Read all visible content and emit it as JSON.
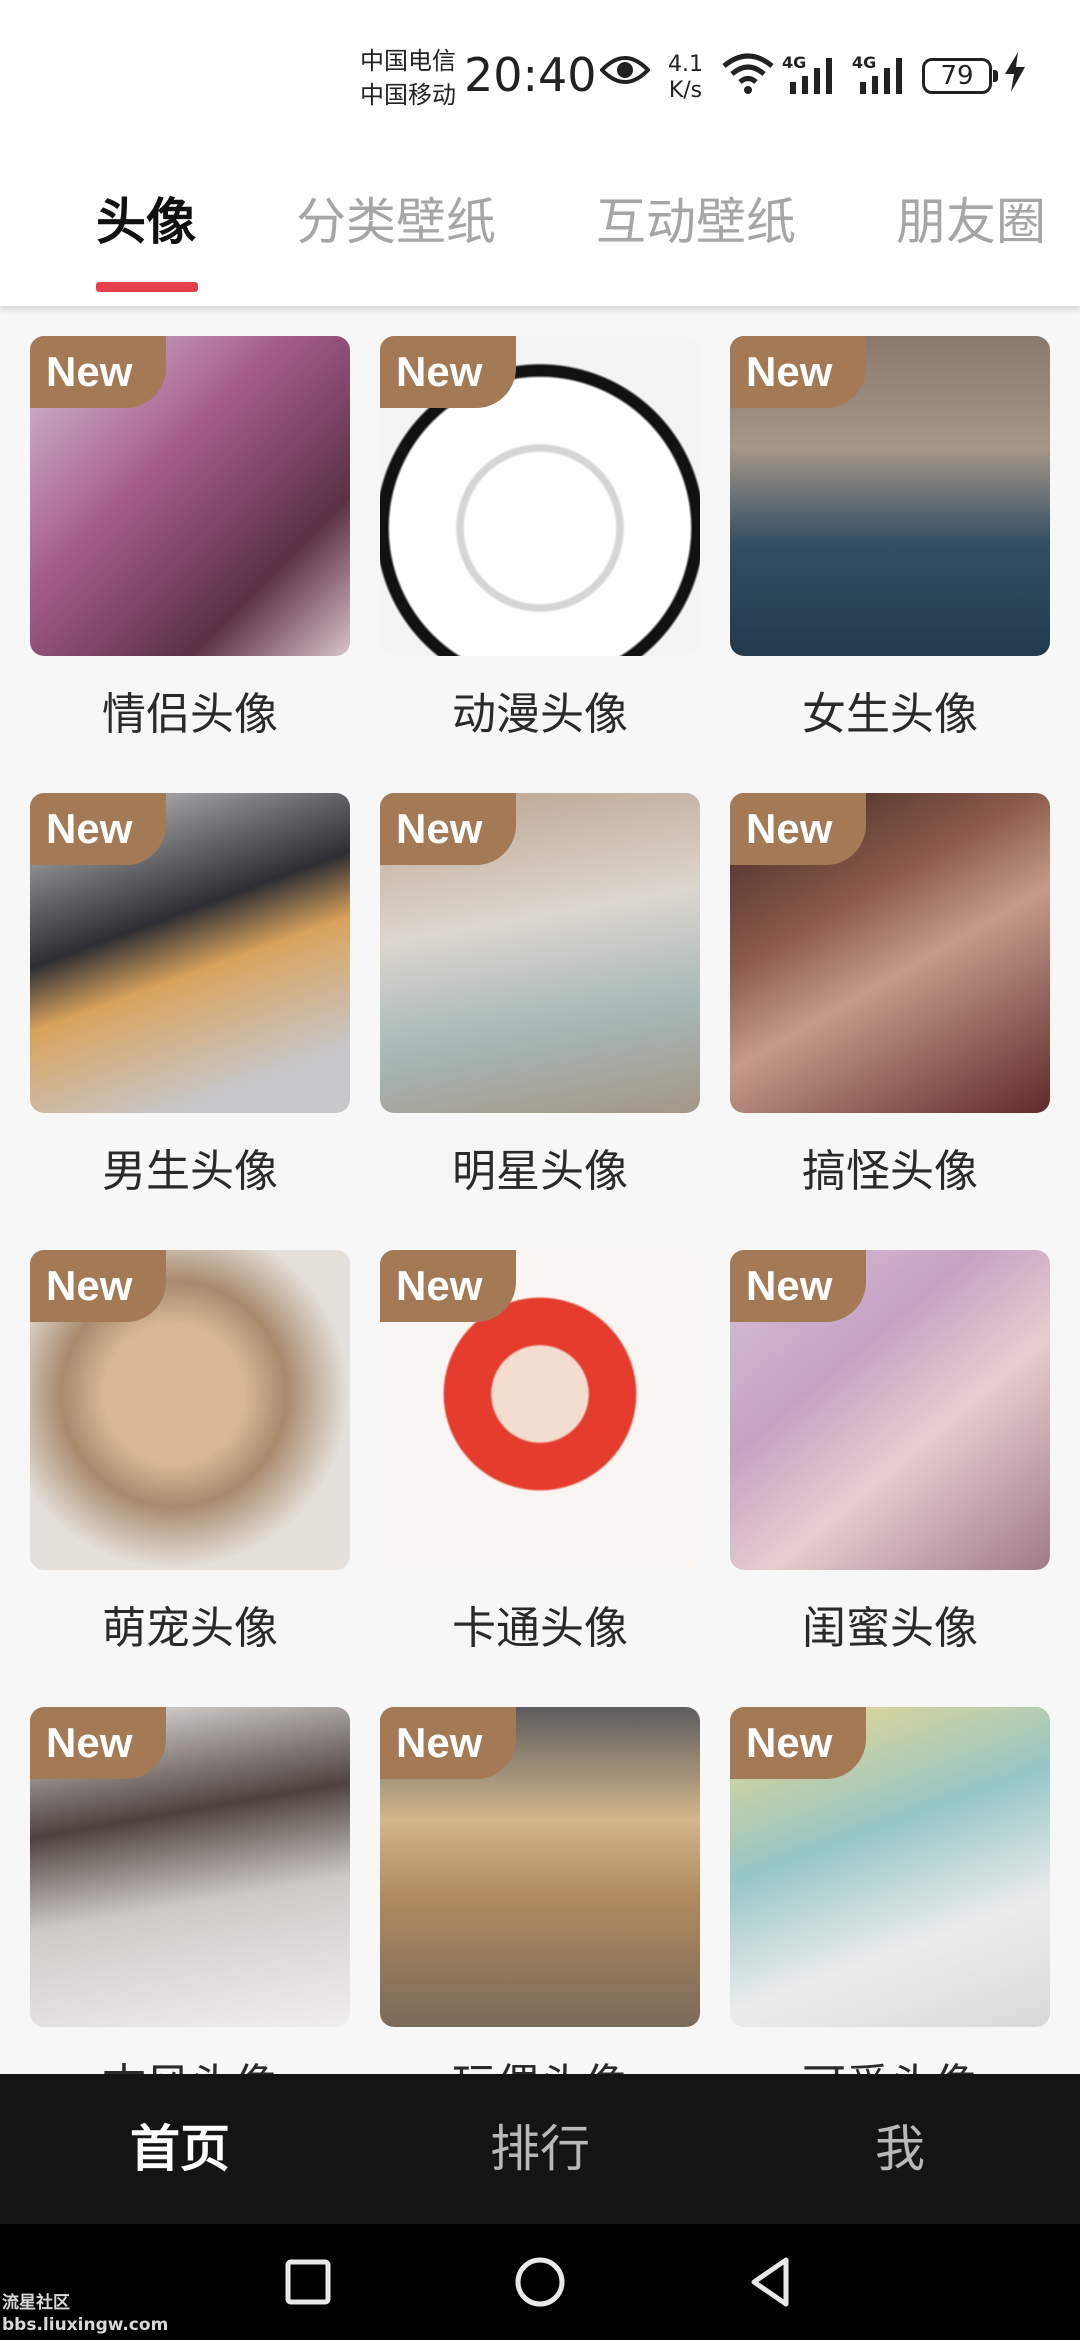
{
  "status_bar": {
    "carrier_1": "中国电信",
    "carrier_2": "中国移动",
    "time": "20:40",
    "net_speed_value": "4.1",
    "net_speed_unit": "K/s",
    "signal_1": "4G",
    "signal_2": "4G",
    "battery": "79",
    "icons": [
      "eye-icon",
      "wifi-icon",
      "signal-icon",
      "signal-icon",
      "battery-icon",
      "charging-icon"
    ]
  },
  "tabs": [
    {
      "label": "头像",
      "active": true
    },
    {
      "label": "分类壁纸",
      "active": false
    },
    {
      "label": "互动壁纸",
      "active": false
    },
    {
      "label": "朋友圈",
      "active": false
    }
  ],
  "grid": {
    "badge": "New",
    "items": [
      {
        "label": "情侣头像"
      },
      {
        "label": "动漫头像"
      },
      {
        "label": "女生头像"
      },
      {
        "label": "男生头像"
      },
      {
        "label": "明星头像"
      },
      {
        "label": "搞怪头像"
      },
      {
        "label": "萌宠头像"
      },
      {
        "label": "卡通头像"
      },
      {
        "label": "闺蜜头像"
      },
      {
        "label": "古风头像"
      },
      {
        "label": "玩偶头像"
      },
      {
        "label": "可爱头像"
      }
    ]
  },
  "bottom_nav": [
    {
      "label": "首页",
      "active": true
    },
    {
      "label": "排行",
      "active": false
    },
    {
      "label": "我",
      "active": false
    }
  ],
  "watermark": {
    "line1": "流星社区",
    "line2": "bbs.liuxingw.com"
  },
  "colors": {
    "accent": "#e6404a",
    "badge": "#a47a56",
    "nav_bg": "#141414"
  }
}
